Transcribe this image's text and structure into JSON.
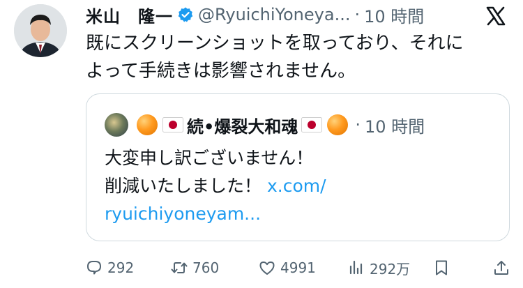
{
  "author": {
    "name": "米山　隆一",
    "handle": "@RyuichiYoneya...",
    "separator": "·",
    "time": "10 時間"
  },
  "post": {
    "line1": "既にスクリーンショットを取っており、それに",
    "line2": "よって手続きは影響されません。"
  },
  "quoted": {
    "name": "続•爆裂大和魂",
    "separator": "·",
    "time": "10 時間",
    "line1": "大変申し訳ございません！",
    "line2_text": "削減いたしました！ ",
    "link_part1": "x.com/",
    "link_part2": "ryuichiyoneyam..."
  },
  "actions": {
    "replies": "292",
    "reposts": "760",
    "likes": "4991",
    "views": "292万"
  },
  "icons": {
    "verified": "verified-badge-icon",
    "platform": "x-logo-icon",
    "reply": "reply-icon",
    "repost": "repost-icon",
    "like": "heart-icon",
    "views": "views-chart-icon",
    "bookmark": "bookmark-icon",
    "share": "share-icon"
  },
  "colors": {
    "text": "#0f1419",
    "muted": "#536471",
    "link": "#1d9bf0",
    "verified": "#1d9bf0",
    "border": "#cfd9de"
  }
}
